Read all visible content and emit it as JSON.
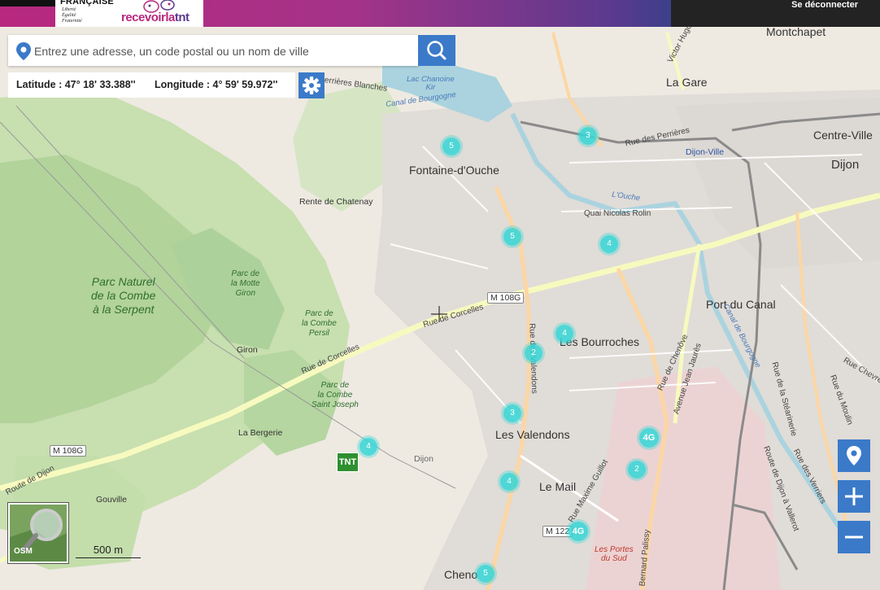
{
  "header": {
    "republic_logo": {
      "title": "FRANÇAISE",
      "motto": [
        "Liberté",
        "Égalité",
        "Fraternité"
      ]
    },
    "brand_logo": {
      "text_a": "recevoirla",
      "text_b": "tnt"
    },
    "logout_label": "Se déconnecter"
  },
  "search": {
    "placeholder": "Entrez une adresse, un code postal ou un nom de ville",
    "value": ""
  },
  "coordinates": {
    "latitude_label": "Latitude : 47° 18' 33.388''",
    "longitude_label": "Longitude : 4° 59' 59.972''"
  },
  "scale_label": "500 m",
  "minimap_label": "OSM",
  "tnt_marker_label": "TNT",
  "clusters": [
    {
      "label": "5"
    },
    {
      "label": "3"
    },
    {
      "label": "5"
    },
    {
      "label": "4"
    },
    {
      "label": "4"
    },
    {
      "label": "2"
    },
    {
      "label": "3"
    },
    {
      "label": "4G"
    },
    {
      "label": "4"
    },
    {
      "label": "2"
    },
    {
      "label": "4"
    },
    {
      "label": "4G"
    },
    {
      "label": "5"
    }
  ],
  "places": {
    "montchapet": "Montchapet",
    "la_gare": "La Gare",
    "centre_ville": "Centre-Ville",
    "dijon": "Dijon",
    "dijon_ville": "Dijon-Ville",
    "fontaine": "Fontaine-d'Ouche",
    "rente": "Rente de Chatenay",
    "port_canal": "Port du Canal",
    "bourroches": "Les Bourroches",
    "giron": "Giron",
    "valendons": "Les Valendons",
    "la_bergerie": "La Bergerie",
    "gouville": "Gouville",
    "le_mail": "Le Mail",
    "chenove": "Cheno",
    "dijon_small": "Dijon",
    "park_combe_serpent": "Parc Naturel\nde la Combe\nà la Serpent",
    "park_motte": "Parc de\nla Motte\nGiron",
    "park_persil": "Parc de\nla Combe\nPersil",
    "park_st_joseph": "Parc de\nla Combe\nSaint Joseph",
    "lac_kir": "Lac Chanoine\nKir",
    "portes_sud": "Les Portes\ndu Sud",
    "road_corcelles": "Rue de Corcelles",
    "road_corcelles2": "Rue de Corcelles",
    "road_nicolas_rolin": "Quai Nicolas Rolin",
    "road_perrieres": "Rue des Perrières",
    "road_chenove": "Rue de Chenôve",
    "road_jean_jaures": "Avenue Jean Jaurès",
    "road_maxime_guillot": "Rue Maxime Guillot",
    "road_victor_hugo": "Victor Hugo",
    "road_route_dijon": "Route de Dijon",
    "road_valendons": "Rue des Valendons",
    "road_stearinerie": "Rue de la Stéarinerie",
    "road_verriers": "Rue des Verriers",
    "road_moulin": "Rue du Moulin",
    "road_chevre": "Rue Chevre",
    "road_route_dijon2": "Route de Dijon à Vallerot",
    "road_ouche": "L'Ouche",
    "road_perrieres_blanches": "Perrières Blanches",
    "road_palissy": "Bernard Palissy",
    "road_canal": "Canal de Bourgogne",
    "road_canal2": "Canal de Bourgogne",
    "shield_m108g": "M 108G",
    "shield_m108g_2": "M 108G",
    "shield_m122": "M 122"
  },
  "colors": {
    "accent": "#3b7ac9",
    "cluster": "#34d6d6",
    "tnt": "#2f8f2f",
    "header_pink": "#b8287f",
    "header_purple": "#5a3a8e"
  }
}
